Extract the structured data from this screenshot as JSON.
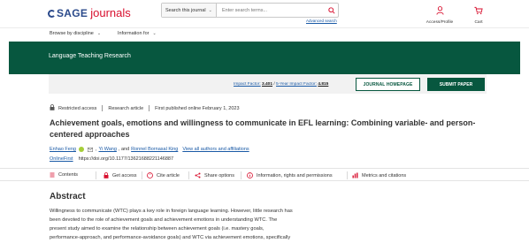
{
  "header": {
    "logo_sage": "SAGE",
    "logo_journals": "journals",
    "search_scope": "Search this journal",
    "search_placeholder": "Enter search terms...",
    "advanced_search": "Advanced search",
    "access_label": "Access/Profile",
    "cart_label": "Cart"
  },
  "nav": {
    "browse": "Browse by discipline",
    "info": "Information for"
  },
  "journal": {
    "name": "Language Teaching Research",
    "impact_label": "Impact Factor:",
    "impact_value": "3.401",
    "five_year_label": "5-Year Impact Factor:",
    "five_year_value": "4.815",
    "homepage_btn": "JOURNAL HOMEPAGE",
    "submit_btn": "SUBMIT PAPER"
  },
  "article": {
    "access": "Restricted access",
    "type": "Research article",
    "published": "First published online February 1, 2023",
    "title": "Achievement goals, emotions and willingness to communicate in EFL learning: Combining variable- and person-centered approaches",
    "author1": "Enhao Feng",
    "author2": "Yi Wang",
    "and": ", and",
    "author3": "Ronnel Bornasal King",
    "view_all": "View all authors and affiliations",
    "onlinefirst": "OnlineFirst",
    "doi": "https://doi.org/10.1177/13621688221146887"
  },
  "toolbar": {
    "contents": "Contents",
    "get_access": "Get access",
    "cite": "Cite article",
    "share": "Share options",
    "info": "Information, rights and permissions",
    "metrics": "Metrics and citations"
  },
  "abstract": {
    "heading": "Abstract",
    "line1": "Willingness to communicate (WTC) plays a key role in foreign language learning. However, little research has",
    "line2": "been devoted to the role of achievement goals and achievement emotions in understanding WTC. The",
    "line3": "present study aimed to examine the relationship between achievement goals (i.e. mastery goals,",
    "line4": "performance-approach, and performance-avoidance goals) and WTC via achievement emotions, specifically"
  },
  "colors": {
    "brand_green": "#07573f",
    "link_blue": "#1a5aa6",
    "sage_blue": "#2b4a8b",
    "journals_red": "#d8102f",
    "orcid_green": "#a6ce39"
  }
}
